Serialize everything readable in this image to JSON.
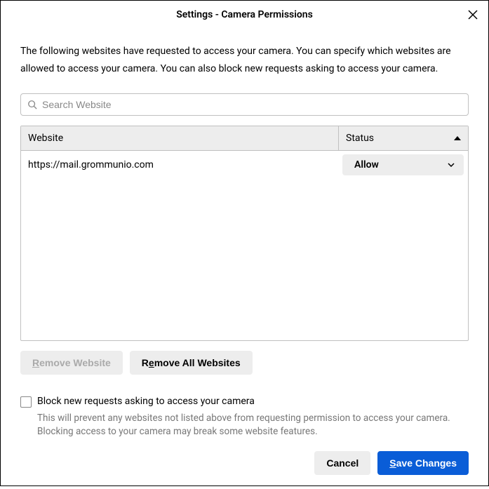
{
  "dialog": {
    "title": "Settings - Camera Permissions"
  },
  "description": "The following websites have requested to access your camera. You can specify which websites are allowed to access your camera. You can also block new requests asking to access your camera.",
  "search": {
    "placeholder": "Search Website"
  },
  "table": {
    "columns": {
      "website": "Website",
      "status": "Status"
    },
    "rows": [
      {
        "website": "https://mail.grommunio.com",
        "status": "Allow"
      }
    ]
  },
  "buttons": {
    "remove_website_prefix": "R",
    "remove_website_rest": "emove Website",
    "remove_all_prefix": "R",
    "remove_all_mid": "e",
    "remove_all_rest": "move All Websites",
    "cancel": "Cancel",
    "save_prefix": "S",
    "save_rest": "ave Changes"
  },
  "checkbox": {
    "label": "Block new requests asking to access your camera",
    "hint": "This will prevent any websites not listed above from requesting permission to access your camera. Blocking access to your camera may break some website features."
  }
}
